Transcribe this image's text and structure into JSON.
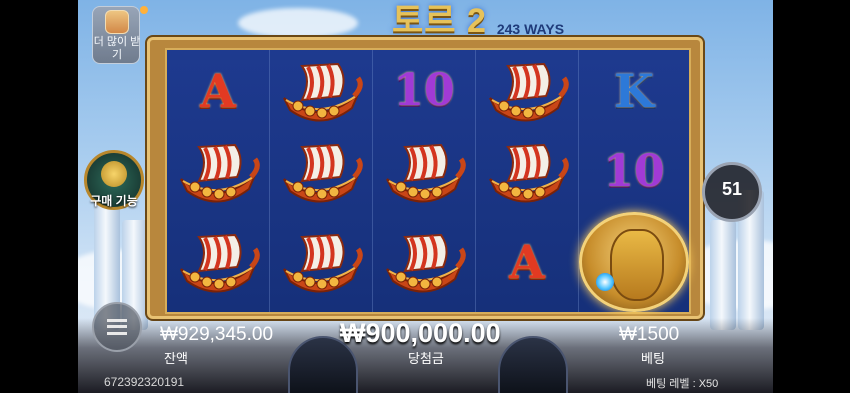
{
  "title": {
    "main": "토르 2",
    "ways": "243 WAYS"
  },
  "side_buttons": {
    "more": "더 많이 받기",
    "buy_feature": "구매 기능",
    "spins_remaining": "51"
  },
  "reels": [
    [
      "A",
      "ship",
      "10",
      "ship",
      "K"
    ],
    [
      "ship",
      "ship",
      "ship",
      "ship",
      "10"
    ],
    [
      "ship",
      "ship",
      "ship",
      "A",
      "hero"
    ]
  ],
  "hud": {
    "balance": "₩929,345.00",
    "balance_label": "잔액",
    "win": "₩900,000.00",
    "win_label": "당첨금",
    "bet": "₩1500",
    "bet_label": "베팅",
    "game_id": "672392320191",
    "bet_level": "베팅 레벨 : X50"
  },
  "colors": {
    "reel_bg": "#1e3a8f",
    "frame_gold": "#d7ad5a",
    "ship_red": "#d3351f",
    "a_red": "#e23a22",
    "ten_purple": "#a13ad6",
    "k_blue": "#2d79d8"
  }
}
